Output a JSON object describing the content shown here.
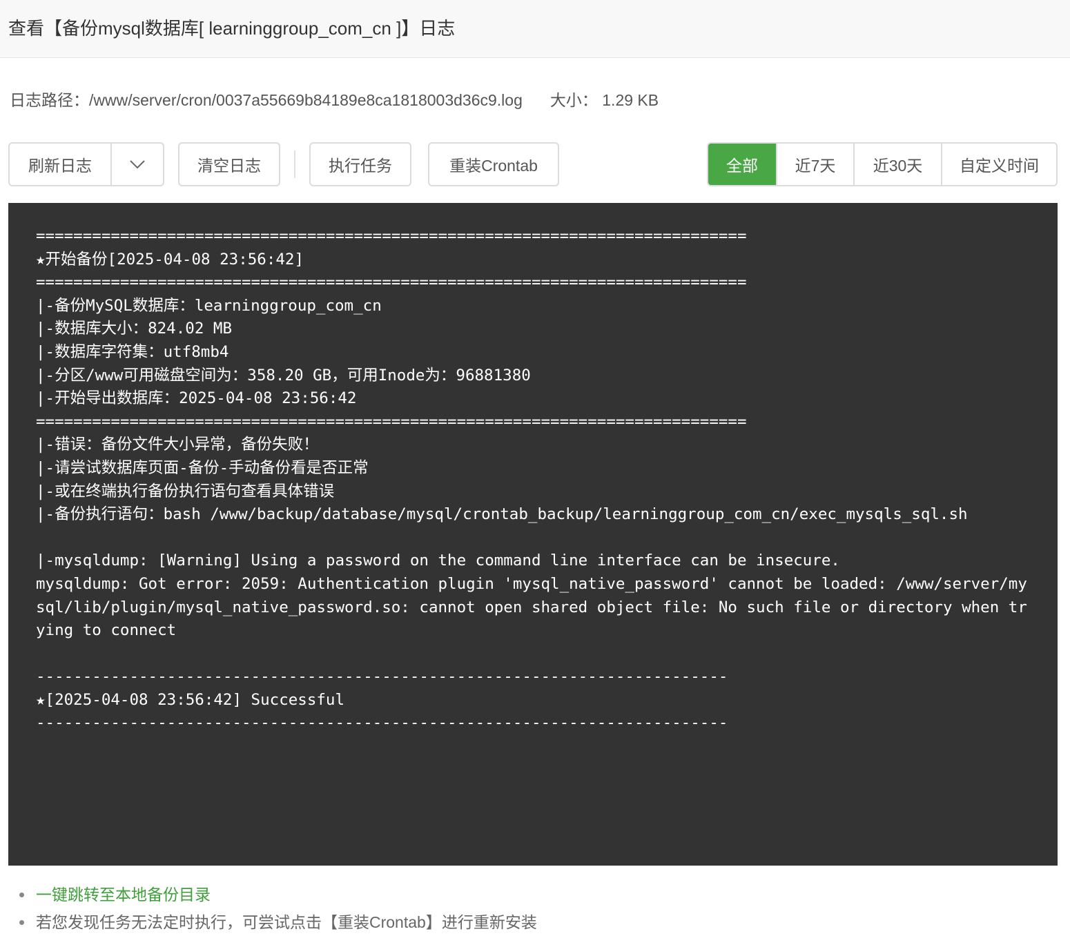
{
  "header": {
    "title": "查看【备份mysql数据库[ learninggroup_com_cn ]】日志"
  },
  "info": {
    "path_label": "日志路径：",
    "path_value": "/www/server/cron/0037a55669b84189e8ca1818003d36c9.log",
    "size_label": "大小：",
    "size_value": "1.29 KB"
  },
  "toolbar": {
    "refresh_label": "刷新日志",
    "clear_label": "清空日志",
    "run_label": "执行任务",
    "reinstall_label": "重装Crontab",
    "caret_icon": "chevron-down-icon"
  },
  "range": {
    "options": [
      "全部",
      "近7天",
      "近30天",
      "自定义时间"
    ],
    "active": "全部",
    "active_color": "#4aa745"
  },
  "log": {
    "lines": [
      "============================================================================",
      "★开始备份[2025-04-08 23:56:42]",
      "============================================================================",
      "|-备份MySQL数据库：learninggroup_com_cn",
      "|-数据库大小：824.02 MB",
      "|-数据库字符集：utf8mb4",
      "|-分区/www可用磁盘空间为：358.20 GB，可用Inode为：96881380",
      "|-开始导出数据库：2025-04-08 23:56:42",
      "============================================================================",
      "|-错误：备份文件大小异常，备份失败！",
      "|-请尝试数据库页面-备份-手动备份看是否正常",
      "|-或在终端执行备份执行语句查看具体错误",
      "|-备份执行语句：bash /www/backup/database/mysql/crontab_backup/learninggroup_com_cn/exec_mysqls_sql.sh",
      "",
      "|-mysqldump: [Warning] Using a password on the command line interface can be insecure.",
      "mysqldump: Got error: 2059: Authentication plugin 'mysql_native_password' cannot be loaded: /www/server/mysql/lib/plugin/mysql_native_password.so: cannot open shared object file: No such file or directory when trying to connect",
      "",
      "--------------------------------------------------------------------------",
      "★[2025-04-08 23:56:42] Successful",
      "--------------------------------------------------------------------------"
    ]
  },
  "notes": {
    "link": "一键跳转至本地备份目录",
    "tip": "若您发现任务无法定时执行，可尝试点击【重装Crontab】进行重新安装"
  }
}
